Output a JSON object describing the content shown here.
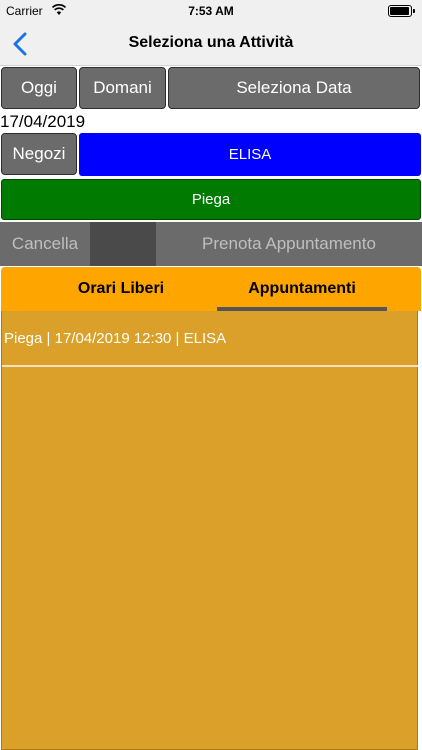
{
  "status_bar": {
    "carrier": "Carrier",
    "time": "7:53 AM"
  },
  "nav": {
    "title": "Seleziona una Attività",
    "back_icon": "chevron-left-icon"
  },
  "date_buttons": {
    "today": "Oggi",
    "tomorrow": "Domani",
    "select_date": "Seleziona Data"
  },
  "selected_date": "17/04/2019",
  "shops": {
    "button": "Negozi",
    "selected": "ELISA"
  },
  "activity": {
    "label": "Piega"
  },
  "actions": {
    "cancel": "Cancella",
    "book": "Prenota Appuntamento"
  },
  "tabs": [
    {
      "label": "Orari Liberi",
      "active": false
    },
    {
      "label": "Appuntamenti",
      "active": true
    }
  ],
  "appointments": [
    {
      "text": "Piega | 17/04/2019 12:30 | ELISA"
    }
  ],
  "colors": {
    "shop_bar": "#0000ff",
    "activity_bar": "#007a00",
    "tabs": "#ffa500",
    "panel": "#daa02a",
    "back_icon": "#1a73e8"
  }
}
